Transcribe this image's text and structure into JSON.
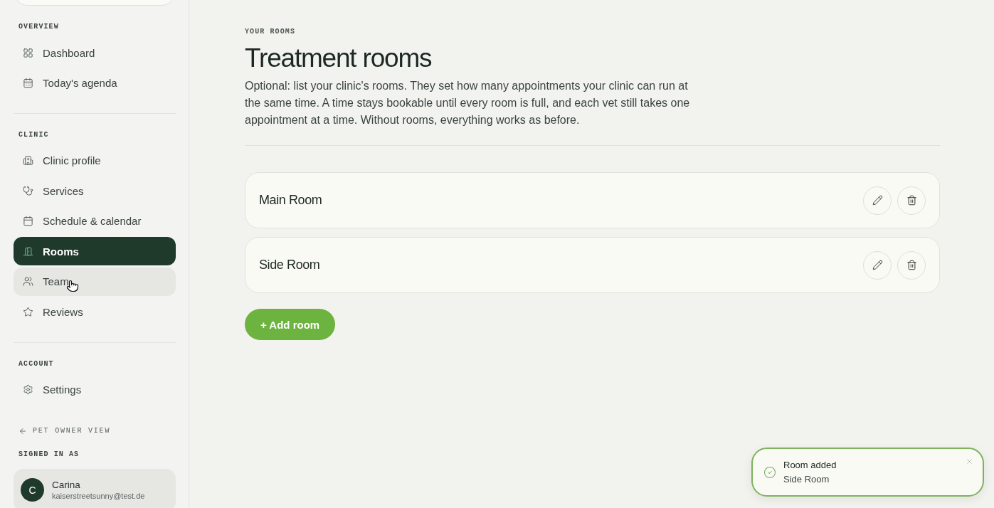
{
  "sidebar": {
    "sections": [
      {
        "heading": "OVERVIEW",
        "items": [
          {
            "label": "Dashboard",
            "selected": false,
            "hovered": false
          },
          {
            "label": "Today's agenda",
            "selected": false,
            "hovered": false
          }
        ]
      },
      {
        "heading": "CLINIC",
        "items": [
          {
            "label": "Clinic profile",
            "selected": false,
            "hovered": false
          },
          {
            "label": "Services",
            "selected": false,
            "hovered": false
          },
          {
            "label": "Schedule & calendar",
            "selected": false,
            "hovered": false
          },
          {
            "label": "Rooms",
            "selected": true,
            "hovered": false
          },
          {
            "label": "Team",
            "selected": false,
            "hovered": true
          },
          {
            "label": "Reviews",
            "selected": false,
            "hovered": false
          }
        ]
      },
      {
        "heading": "ACCOUNT",
        "items": [
          {
            "label": "Settings",
            "selected": false,
            "hovered": false
          }
        ]
      }
    ],
    "pet_owner_link": "PET OWNER VIEW",
    "signed_in": {
      "heading": "SIGNED IN AS",
      "initial": "C",
      "name": "Carina",
      "email": "kaiserstreetsunny@test.de"
    }
  },
  "main": {
    "eyebrow": "YOUR ROOMS",
    "title": "Treatment rooms",
    "description": "Optional: list your clinic's rooms. They set how many appointments your clinic can run at the same time. A time stays bookable until every room is full, and each vet still takes one appointment at a time. Without rooms, everything works as before.",
    "rooms": [
      {
        "name": "Main Room"
      },
      {
        "name": "Side Room"
      }
    ],
    "add_button": "+ Add room"
  },
  "toast": {
    "title": "Room added",
    "message": "Side Room"
  }
}
